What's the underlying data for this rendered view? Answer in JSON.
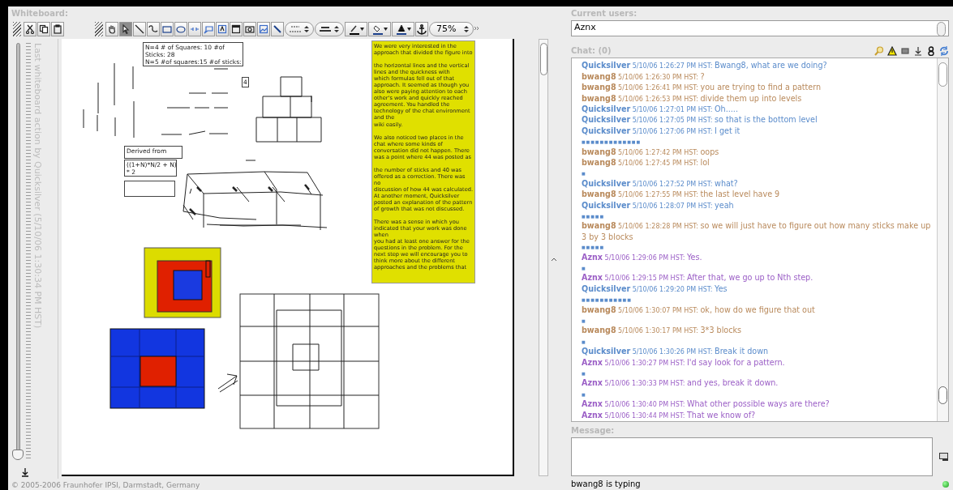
{
  "whiteboard": {
    "title": "Whiteboard:",
    "edit_tools": [
      {
        "kind": "cut"
      },
      {
        "kind": "copy"
      },
      {
        "kind": "paste"
      }
    ],
    "draw_tools": [
      {
        "kind": "hand",
        "selected": false
      },
      {
        "kind": "pointer",
        "selected": true
      },
      {
        "kind": "line",
        "selected": false
      },
      {
        "kind": "curve",
        "selected": false
      },
      {
        "kind": "rect",
        "selected": false
      },
      {
        "kind": "ellipse",
        "selected": false
      },
      {
        "kind": "connector",
        "selected": false
      },
      {
        "kind": "callout",
        "selected": false
      },
      {
        "kind": "text",
        "selected": false
      },
      {
        "kind": "window",
        "selected": false
      },
      {
        "kind": "camera",
        "selected": false
      },
      {
        "kind": "picture",
        "selected": false
      },
      {
        "kind": "link",
        "selected": false
      }
    ],
    "zoom": "75%",
    "history": {
      "level": 1,
      "caption": "Last whiteboard action by Quicksilver (5/10/06 1:30:34 PM HST)"
    },
    "text_boxes": [
      {
        "kind": "counts",
        "lines": [
          "N=4 # of Squares: 10 #of",
          "Sticks: 28",
          "N=5 #of squares:15 #of sticks:"
        ]
      },
      {
        "kind": "digit",
        "lines": [
          "4"
        ]
      },
      {
        "kind": "derived",
        "lines": [
          "Derived from"
        ]
      },
      {
        "kind": "formula",
        "lines": [
          "((1+N)*N/2 + N)",
          "* 2"
        ]
      },
      {
        "kind": "blank"
      }
    ],
    "note": [
      [
        "We were very interested in the",
        "approach that divided the figure into"
      ],
      [
        "the horizontal lines and the vertical",
        "lines and the quickness with",
        "which formulas fell out of that",
        "approach. It seemed as though you",
        "also were paying attention to each",
        "other's work and quickly reached",
        "agreement. You handled the",
        "technology of the chat environment",
        "and the",
        "wiki easily."
      ],
      [
        "We also noticed two places in the",
        "chat where some kinds of",
        "conversation did not happen. There",
        "was a point where 44 was posted as"
      ],
      [
        "the number of sticks and 40 was",
        "offered as a correction. There was",
        "no",
        "discussion of how 44 was calculated.",
        "At another moment, Quicksilver",
        "posted an explanation of the pattern",
        "of growth that was not discussed."
      ],
      [
        "There was a sense in which you",
        "indicated that your work was done",
        "when",
        "you had at least one answer for the",
        "questions in the problem. For the",
        "next step we will encourage you to",
        "think more about the different",
        "approaches and the problems that"
      ]
    ],
    "copyright": "© 2005-2006 Fraunhofer IPSI, Darmstadt, Germany"
  },
  "users": {
    "title": "Current users:",
    "items": [
      "Aznx"
    ]
  },
  "chat": {
    "title": "Chat: (0)",
    "messages": [
      {
        "kind": "message",
        "user": "Quicksilver",
        "time": "5/10/06 1:26:27 PM HST:",
        "text": "Bwang8, what are we doing?",
        "color": "#5b8ccb"
      },
      {
        "kind": "message",
        "user": "bwang8",
        "time": "5/10/06 1:26:30 PM HST:",
        "text": "?",
        "color": "#b98a5c"
      },
      {
        "kind": "message",
        "user": "bwang8",
        "time": "5/10/06 1:26:41 PM HST:",
        "text": "you are trying to find a pattern",
        "color": "#b98a5c"
      },
      {
        "kind": "message",
        "user": "bwang8",
        "time": "5/10/06 1:26:53 PM HST:",
        "text": "divide them up into levels",
        "color": "#b98a5c"
      },
      {
        "kind": "message",
        "user": "Quicksilver",
        "time": "5/10/06 1:27:01 PM HST:",
        "text": "Oh.....",
        "color": "#5b8ccb"
      },
      {
        "kind": "message",
        "user": "Quicksilver",
        "time": "5/10/06 1:27:05 PM HST:",
        "text": "so that is the bottom level",
        "color": "#5b8ccb"
      },
      {
        "kind": "message",
        "user": "Quicksilver",
        "time": "5/10/06 1:27:06 PM HST:",
        "text": "I get it",
        "color": "#5b8ccb"
      },
      {
        "kind": "marker",
        "text": "■■■■■■■■■■■■■"
      },
      {
        "kind": "message",
        "user": "bwang8",
        "time": "5/10/06 1:27:42 PM HST:",
        "text": "oops",
        "color": "#b98a5c"
      },
      {
        "kind": "message",
        "user": "bwang8",
        "time": "5/10/06 1:27:45 PM HST:",
        "text": "lol",
        "color": "#b98a5c"
      },
      {
        "kind": "marker",
        "text": "■"
      },
      {
        "kind": "message",
        "user": "Quicksilver",
        "time": "5/10/06 1:27:52 PM HST:",
        "text": "what?",
        "color": "#5b8ccb"
      },
      {
        "kind": "message",
        "user": "bwang8",
        "time": "5/10/06 1:27:55 PM HST:",
        "text": "the last level have 9",
        "color": "#b98a5c"
      },
      {
        "kind": "message",
        "user": "Quicksilver",
        "time": "5/10/06 1:28:07 PM HST:",
        "text": "yeah",
        "color": "#5b8ccb"
      },
      {
        "kind": "marker",
        "text": "■■■■■"
      },
      {
        "kind": "message",
        "user": "bwang8",
        "time": "5/10/06 1:28:28 PM HST:",
        "text": "so we will just have to figure out how many sticks make up 3 by 3 blocks",
        "color": "#b98a5c"
      },
      {
        "kind": "marker",
        "text": "■■■■■"
      },
      {
        "kind": "message",
        "user": "Aznx",
        "time": "5/10/06 1:29:06 PM HST:",
        "text": "Yes.",
        "color": "#9b5fc6"
      },
      {
        "kind": "marker",
        "text": "■"
      },
      {
        "kind": "message",
        "user": "Aznx",
        "time": "5/10/06 1:29:15 PM HST:",
        "text": "After that, we go up to Nth step.",
        "color": "#9b5fc6"
      },
      {
        "kind": "message",
        "user": "Quicksilver",
        "time": "5/10/06 1:29:20 PM HST:",
        "text": "Yes",
        "color": "#5b8ccb"
      },
      {
        "kind": "marker",
        "text": "■■■■■■■■■■■"
      },
      {
        "kind": "message",
        "user": "bwang8",
        "time": "5/10/06 1:30:07 PM HST:",
        "text": "ok, how do we figure that out",
        "color": "#b98a5c"
      },
      {
        "kind": "marker",
        "text": "■"
      },
      {
        "kind": "message",
        "user": "bwang8",
        "time": "5/10/06 1:30:17 PM HST:",
        "text": "3*3 blocks",
        "color": "#b98a5c"
      },
      {
        "kind": "marker",
        "text": "■"
      },
      {
        "kind": "message",
        "user": "Quicksilver",
        "time": "5/10/06 1:30:26 PM HST:",
        "text": "Break it down",
        "color": "#5b8ccb"
      },
      {
        "kind": "message",
        "user": "Aznx",
        "time": "5/10/06 1:30:27 PM HST:",
        "text": "I'd say look for a pattern.",
        "color": "#9b5fc6"
      },
      {
        "kind": "marker",
        "text": "■"
      },
      {
        "kind": "message",
        "user": "Aznx",
        "time": "5/10/06 1:30:33 PM HST:",
        "text": "and yes, break it down.",
        "color": "#9b5fc6"
      },
      {
        "kind": "marker",
        "text": "■"
      },
      {
        "kind": "message",
        "user": "Aznx",
        "time": "5/10/06 1:30:40 PM HST:",
        "text": "What other possible ways are there?",
        "color": "#9b5fc6"
      },
      {
        "kind": "message",
        "user": "Aznx",
        "time": "5/10/06 1:30:44 PM HST:",
        "text": "That we know of?",
        "color": "#9b5fc6"
      }
    ],
    "tools": [
      {
        "kind": "search"
      },
      {
        "kind": "warning"
      },
      {
        "kind": "square"
      },
      {
        "kind": "download"
      },
      {
        "kind": "person"
      },
      {
        "kind": "refresh"
      }
    ]
  },
  "message": {
    "title": "Message:"
  },
  "status": {
    "text": "bwang8 is typing",
    "online": true
  }
}
